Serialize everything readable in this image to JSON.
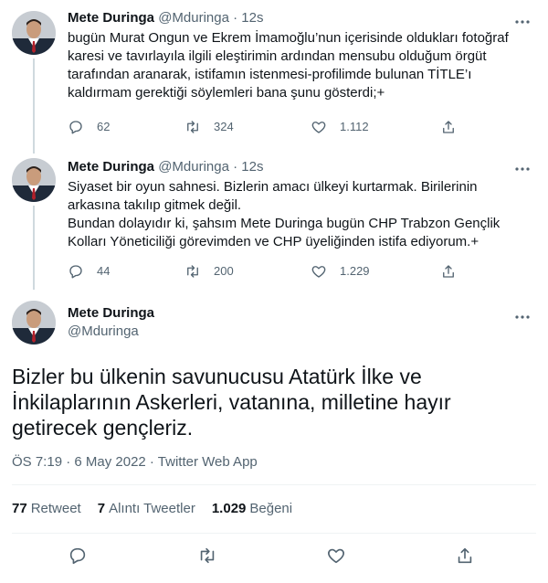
{
  "tweet1": {
    "name": "Mete Duringa",
    "handle": "@Mduringa",
    "dot": "·",
    "time": "12s",
    "text": "bugün Murat Ongun ve Ekrem İmamoğlu’nun içerisinde oldukları fotoğraf\nkaresi ve tavırlayıla ilgili eleştirimin ardından mensubu olduğum örgüt\ntarafından aranarak, istifamın istenmesi-profilimde bulunan TİTLE’ı\nkaldırmam gerektiği söylemleri bana şunu gösterdi;+",
    "replies": "62",
    "retweets": "324",
    "likes": "1.112",
    "more_icon": "more-dots-icon"
  },
  "tweet2": {
    "name": "Mete Duringa",
    "handle": "@Mduringa",
    "dot": "·",
    "time": "12s",
    "text": "Siyaset bir oyun sahnesi. Bizlerin amacı ülkeyi kurtarmak. Birilerinin\narkasına takılıp gitmek değil.\nBundan dolayıdır ki, şahsım Mete Duringa bugün CHP Trabzon Gençlik\nKolları Yöneticiliği görevimden ve CHP üyeliğinden istifa ediyorum.+",
    "replies": "44",
    "retweets": "200",
    "likes": "1.229"
  },
  "main": {
    "name": "Mete Duringa",
    "handle": "@Mduringa",
    "text": "Bizler bu ülkenin savunucusu Atatürk İlke ve İnkilaplarının Askerleri, vatanına, milletine hayır getirecek gençleriz.",
    "meta": "ÖS 7:19 · 6 May 2022 · Twitter Web App",
    "retweet_count": "77",
    "retweet_label": "Retweet",
    "quote_count": "7",
    "quote_label": "Alıntı Tweetler",
    "like_count": "1.029",
    "like_label": "Beğeni"
  },
  "colors": {
    "text": "#0f1419",
    "secondary": "#536471",
    "divider": "#eff3f4",
    "thread_line": "#cfd9de"
  }
}
